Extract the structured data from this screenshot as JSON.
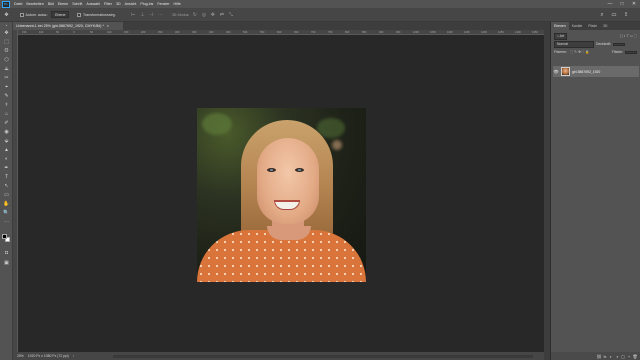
{
  "app": {
    "logo": "Ps"
  },
  "menu": [
    "Datei",
    "Bearbeiten",
    "Bild",
    "Ebene",
    "Schrift",
    "Auswahl",
    "Filter",
    "3D",
    "Ansicht",
    "Plug-ins",
    "Fenster",
    "Hilfe"
  ],
  "window_controls": {
    "minimize": "—",
    "maximize": "□",
    "close": "✕"
  },
  "options": {
    "auto_select_label": "Autom. ausw.:",
    "auto_select_value": "Ebene",
    "transform_label": "Transformationsstrg.",
    "mode_3d": "3D-Modus:"
  },
  "document_tab": {
    "title": "Unbenannt-1 bei 25% (girl-5867692_1920, CMYK/8#) *",
    "close": "×"
  },
  "ruler_ticks": [
    "150",
    "100",
    "50",
    "0",
    "50",
    "100",
    "150",
    "200",
    "250",
    "300",
    "350",
    "400",
    "450",
    "500",
    "550",
    "600",
    "650",
    "700",
    "750",
    "800",
    "850",
    "900",
    "950",
    "1000",
    "1050",
    "1100",
    "1150",
    "1200",
    "1250",
    "1300",
    "1350"
  ],
  "tools": [
    "✥",
    "⬚",
    "ʘ",
    "⬡",
    "⟁",
    "✂",
    "⌖",
    "✎",
    "⚕",
    "⌂",
    "✐",
    "◉",
    "⬙",
    "▲",
    "◐",
    "✒",
    "T",
    "↖",
    "▭",
    "✋",
    "🔍",
    "⋯"
  ],
  "panel": {
    "tabs": [
      "Ebenen",
      "Kanäle",
      "Pfade",
      "3D"
    ],
    "filter": "Art",
    "blend_mode": "Normal",
    "opacity_label": "Deckkraft:",
    "lock_label": "Fixieren:",
    "fill_label": "Fläche:",
    "layer_name": "girl-5867692_1920",
    "footer_icons": [
      "⛓",
      "fx",
      "◐",
      "◑",
      "▢",
      "+",
      "🗑"
    ]
  },
  "status": {
    "zoom": "25%",
    "doc_size": "1920 Px x 1080 Px (72 ppi)",
    "arrow": "›"
  },
  "colors": {
    "accent": "#31a8ff",
    "canvas_bg": "#282828",
    "ui_bg": "#535353"
  }
}
